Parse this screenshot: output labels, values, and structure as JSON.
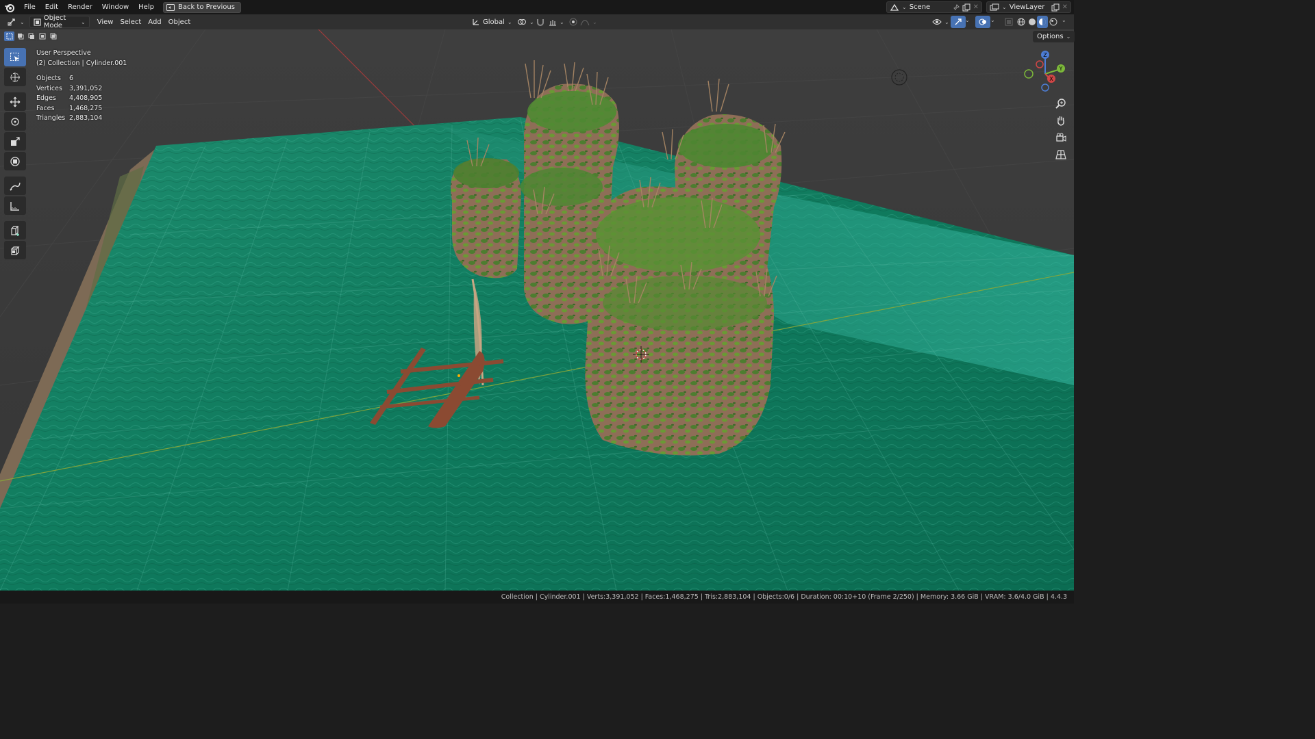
{
  "menu": {
    "items": [
      "File",
      "Edit",
      "Render",
      "Window",
      "Help"
    ],
    "back_button": "Back to Previous",
    "scene_name": "Scene",
    "view_layer": "ViewLayer"
  },
  "header": {
    "mode": "Object Mode",
    "view": "View",
    "select": "Select",
    "add": "Add",
    "object": "Object",
    "transform_orientation": "Global",
    "options": "Options"
  },
  "overlay": {
    "perspective": "User Perspective",
    "collection": "(2) Collection | Cylinder.001",
    "stats": [
      {
        "label": "Objects",
        "value": "6"
      },
      {
        "label": "Vertices",
        "value": "3,391,052"
      },
      {
        "label": "Edges",
        "value": "4,408,905"
      },
      {
        "label": "Faces",
        "value": "1,468,275"
      },
      {
        "label": "Triangles",
        "value": "2,883,104"
      }
    ]
  },
  "gizmo": {
    "z": "Z",
    "y": "Y",
    "x": "X"
  },
  "statusbar": {
    "text": "Collection | Cylinder.001 | Verts:3,391,052 | Faces:1,468,275 | Tris:2,883,104 | Objects:0/6 | Duration: 00:10+10 (Frame 2/250) | Memory: 3.66 GiB | VRAM: 3.6/4.0 GiB | 4.4.3"
  },
  "colors": {
    "water": "#0e7a5c",
    "water_light": "#2aa58c",
    "rock": "#8a6a52",
    "moss": "#3f7a2a",
    "boat": "#8b4a32",
    "accent": "#4772b3"
  }
}
